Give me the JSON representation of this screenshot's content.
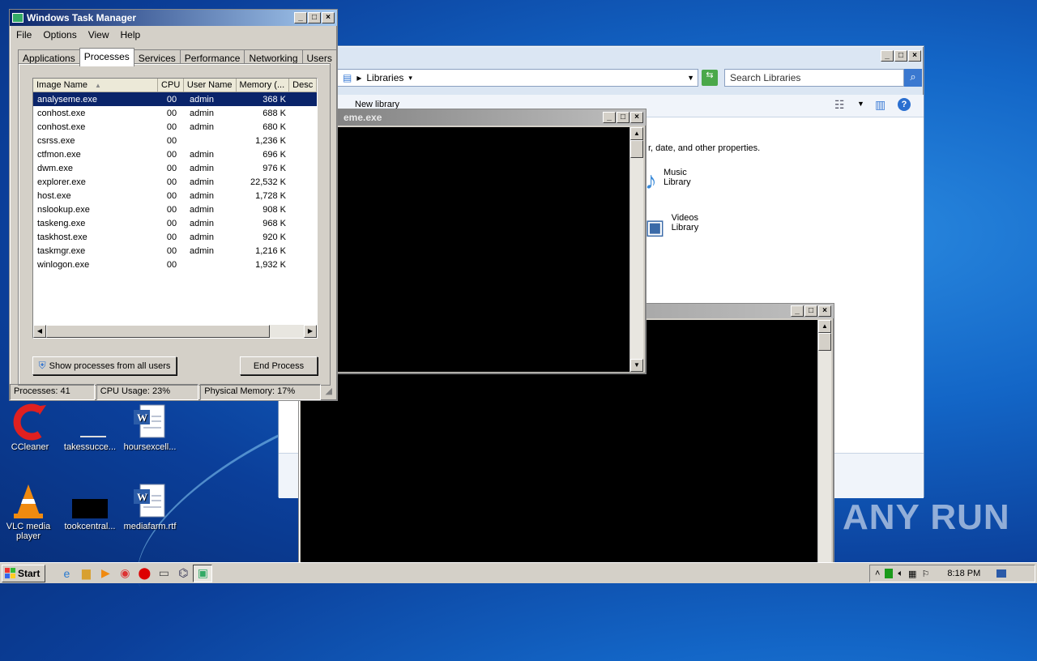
{
  "taskmgr": {
    "title": "Windows Task Manager",
    "menu": [
      "File",
      "Options",
      "View",
      "Help"
    ],
    "tabs": [
      "Applications",
      "Processes",
      "Services",
      "Performance",
      "Networking",
      "Users"
    ],
    "columns": [
      "Image Name",
      "CPU",
      "User Name",
      "Memory (...",
      "Desc"
    ],
    "processes": [
      [
        "analyseme.exe",
        "00",
        "admin",
        "368 K"
      ],
      [
        "conhost.exe",
        "00",
        "admin",
        "688 K"
      ],
      [
        "conhost.exe",
        "00",
        "admin",
        "680 K"
      ],
      [
        "csrss.exe",
        "00",
        "",
        "1,236 K"
      ],
      [
        "ctfmon.exe",
        "00",
        "admin",
        "696 K"
      ],
      [
        "dwm.exe",
        "00",
        "admin",
        "976 K"
      ],
      [
        "explorer.exe",
        "00",
        "admin",
        "22,532 K"
      ],
      [
        "host.exe",
        "00",
        "admin",
        "1,728 K"
      ],
      [
        "nslookup.exe",
        "00",
        "admin",
        "908 K"
      ],
      [
        "taskeng.exe",
        "00",
        "admin",
        "968 K"
      ],
      [
        "taskhost.exe",
        "00",
        "admin",
        "920 K"
      ],
      [
        "taskmgr.exe",
        "00",
        "admin",
        "1,216 K"
      ],
      [
        "winlogon.exe",
        "00",
        "",
        "1,932 K"
      ]
    ],
    "show_all_label": "Show processes from all users",
    "end_process_label": "End Process",
    "status_processes": "Processes: 41",
    "status_cpu": "CPU Usage: 23%",
    "status_memory": "Physical Memory: 17%"
  },
  "explorer": {
    "address": "Libraries",
    "search_placeholder": "Search Libraries",
    "new_library": "New library",
    "hint": "r, date, and other properties.",
    "music_line1": "Music",
    "music_line2": "Library",
    "videos_line1": "Videos",
    "videos_line2": "Library"
  },
  "console1": {
    "title": "eme.exe"
  },
  "desktop_icons": {
    "ccleaner": "CCleaner",
    "takessucce": "takessucce...",
    "hoursexcell": "hoursexcell...",
    "vlc": "VLC media player",
    "tookcentral": "tookcentral...",
    "mediafarm": "mediafarm.rtf"
  },
  "taskbar": {
    "start": "Start",
    "clock": "8:18 PM"
  },
  "watermark": "ANY RUN",
  "colors": {
    "selection": "#0a246a",
    "titlebar": "#0a246a"
  }
}
